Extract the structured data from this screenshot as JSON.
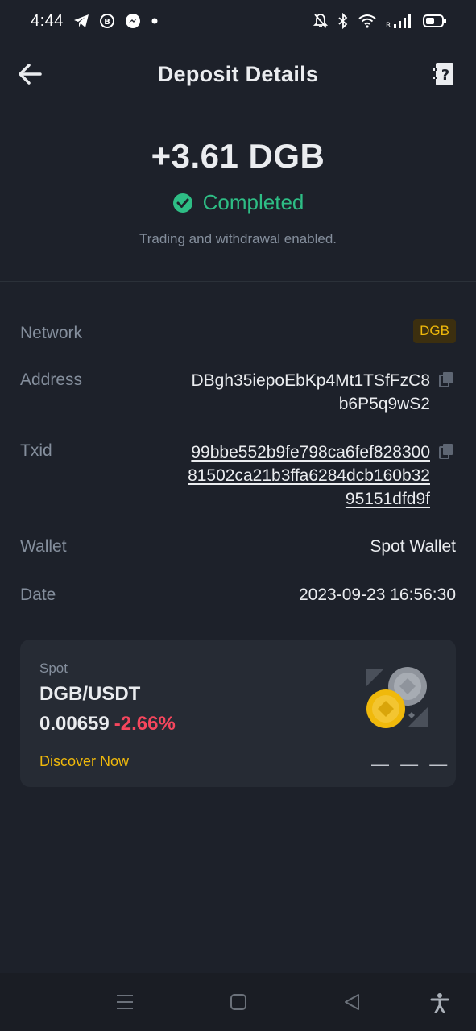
{
  "status_bar": {
    "time": "4:44",
    "left_icons": [
      "telegram-icon",
      "b-circle-icon",
      "messenger-icon",
      "dot-icon"
    ],
    "right_icons": [
      "bell-muted-icon",
      "bluetooth-icon",
      "wifi-icon",
      "signal-icon",
      "battery-icon"
    ],
    "signal_label": "R"
  },
  "header": {
    "title": "Deposit Details",
    "back_icon": "arrow-left-icon",
    "help_icon": "help-document-icon"
  },
  "summary": {
    "amount": "+3.61 DGB",
    "status": "Completed",
    "status_icon": "check-circle-icon",
    "note": "Trading and withdrawal enabled."
  },
  "details": {
    "network_label": "Network",
    "network_value": "DGB",
    "address_label": "Address",
    "address_lines": [
      "DBgh35iepoEbKp4Mt1TSfFzC8",
      "b6P5q9wS2"
    ],
    "txid_label": "Txid",
    "txid_lines": [
      "99bbe552b9fe798ca6fef828300",
      "81502ca21b3ffa6284dcb160b32",
      "95151dfd9f"
    ],
    "wallet_label": "Wallet",
    "wallet_value": "Spot Wallet",
    "date_label": "Date",
    "date_value": "2023-09-23 16:56:30"
  },
  "spot_card": {
    "label": "Spot",
    "pair": "DGB/USDT",
    "price": "0.00659",
    "change": "-2.66%",
    "cta": "Discover Now",
    "dashes": "— — —"
  },
  "nav_bar": {
    "icons": [
      "menu-icon",
      "home-square-icon",
      "back-triangle-icon",
      "accessibility-icon"
    ]
  },
  "colors": {
    "background": "#1d212a",
    "card": "#262b34",
    "accent_yellow": "#f0b90b",
    "success_green": "#2ebd85",
    "negative_red": "#f6465d",
    "muted_text": "#848e9c"
  }
}
